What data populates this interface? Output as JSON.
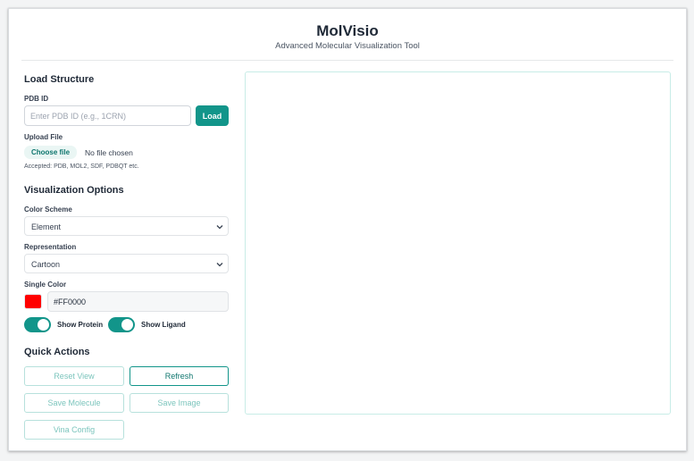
{
  "app": {
    "title": "MolVisio",
    "subtitle": "Advanced Molecular Visualization Tool"
  },
  "load_structure": {
    "heading": "Load Structure",
    "pdb_label": "PDB ID",
    "pdb_placeholder": "Enter PDB ID (e.g., 1CRN)",
    "pdb_value": "",
    "load_button": "Load",
    "upload_label": "Upload File",
    "choose_file_button": "Choose file",
    "no_file_text": "No file chosen",
    "accepted_text": "Accepted: PDB, MOL2, SDF, PDBQT etc."
  },
  "visualization": {
    "heading": "Visualization Options",
    "color_scheme_label": "Color Scheme",
    "color_scheme_value": "Element",
    "representation_label": "Representation",
    "representation_value": "Cartoon",
    "single_color_label": "Single Color",
    "single_color_value": "#FF0000",
    "show_protein_label": "Show Protein",
    "show_protein_on": true,
    "show_ligand_label": "Show Ligand",
    "show_ligand_on": true
  },
  "quick_actions": {
    "heading": "Quick Actions",
    "reset_view": "Reset View",
    "refresh": "Refresh",
    "save_molecule": "Save Molecule",
    "save_image": "Save Image",
    "vina_config": "Vina Config"
  },
  "colors": {
    "accent": "#12958a",
    "swatch": "#FF0000"
  }
}
